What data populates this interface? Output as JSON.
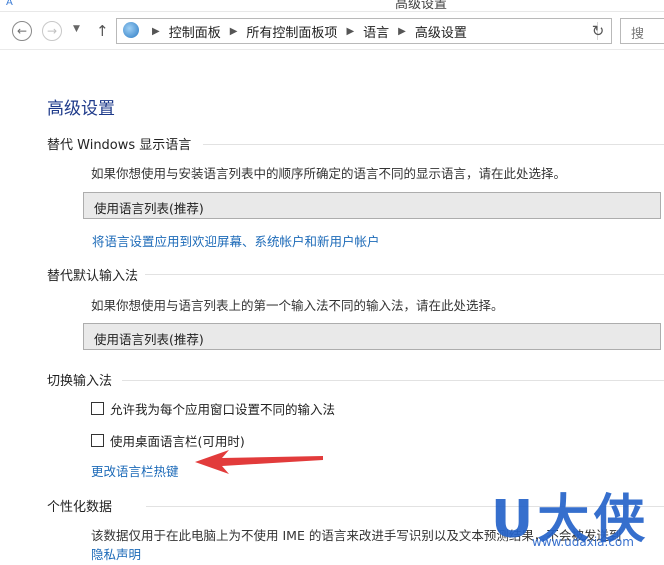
{
  "window": {
    "title": "高级设置"
  },
  "navigation": {
    "breadcrumbs": [
      "控制面板",
      "所有控制面板项",
      "语言",
      "高级设置"
    ],
    "search_placeholder": "搜"
  },
  "page": {
    "title": "高级设置"
  },
  "sections": {
    "display_language": {
      "heading": "替代 Windows 显示语言",
      "description": "如果你想使用与安装语言列表中的顺序所确定的语言不同的显示语言，请在此处选择。",
      "select_value": "使用语言列表(推荐)",
      "link": "将语言设置应用到欢迎屏幕、系统帐户和新用户帐户"
    },
    "default_input": {
      "heading": "替代默认输入法",
      "description": "如果你想使用与语言列表上的第一个输入法不同的输入法，请在此处选择。",
      "select_value": "使用语言列表(推荐)"
    },
    "switch_input": {
      "heading": "切换输入法",
      "options": [
        {
          "label": "允许我为每个应用窗口设置不同的输入法",
          "checked": false
        },
        {
          "label": "使用桌面语言栏(可用时)",
          "checked": false
        }
      ],
      "link": "更改语言栏热键"
    },
    "personalization": {
      "heading": "个性化数据",
      "description": "该数据仅用于在此电脑上为不使用 IME 的语言来改进手写识别以及文本预测结果，不会被发送到",
      "link": "隐私声明"
    }
  },
  "watermark": {
    "brand": "U大侠",
    "url": "www.udaxia.com"
  },
  "colors": {
    "title_blue": "#1e3a8a",
    "link_blue": "#1c6ab8",
    "annotation_red": "#e23b3b",
    "watermark_blue": "#2563c9"
  }
}
